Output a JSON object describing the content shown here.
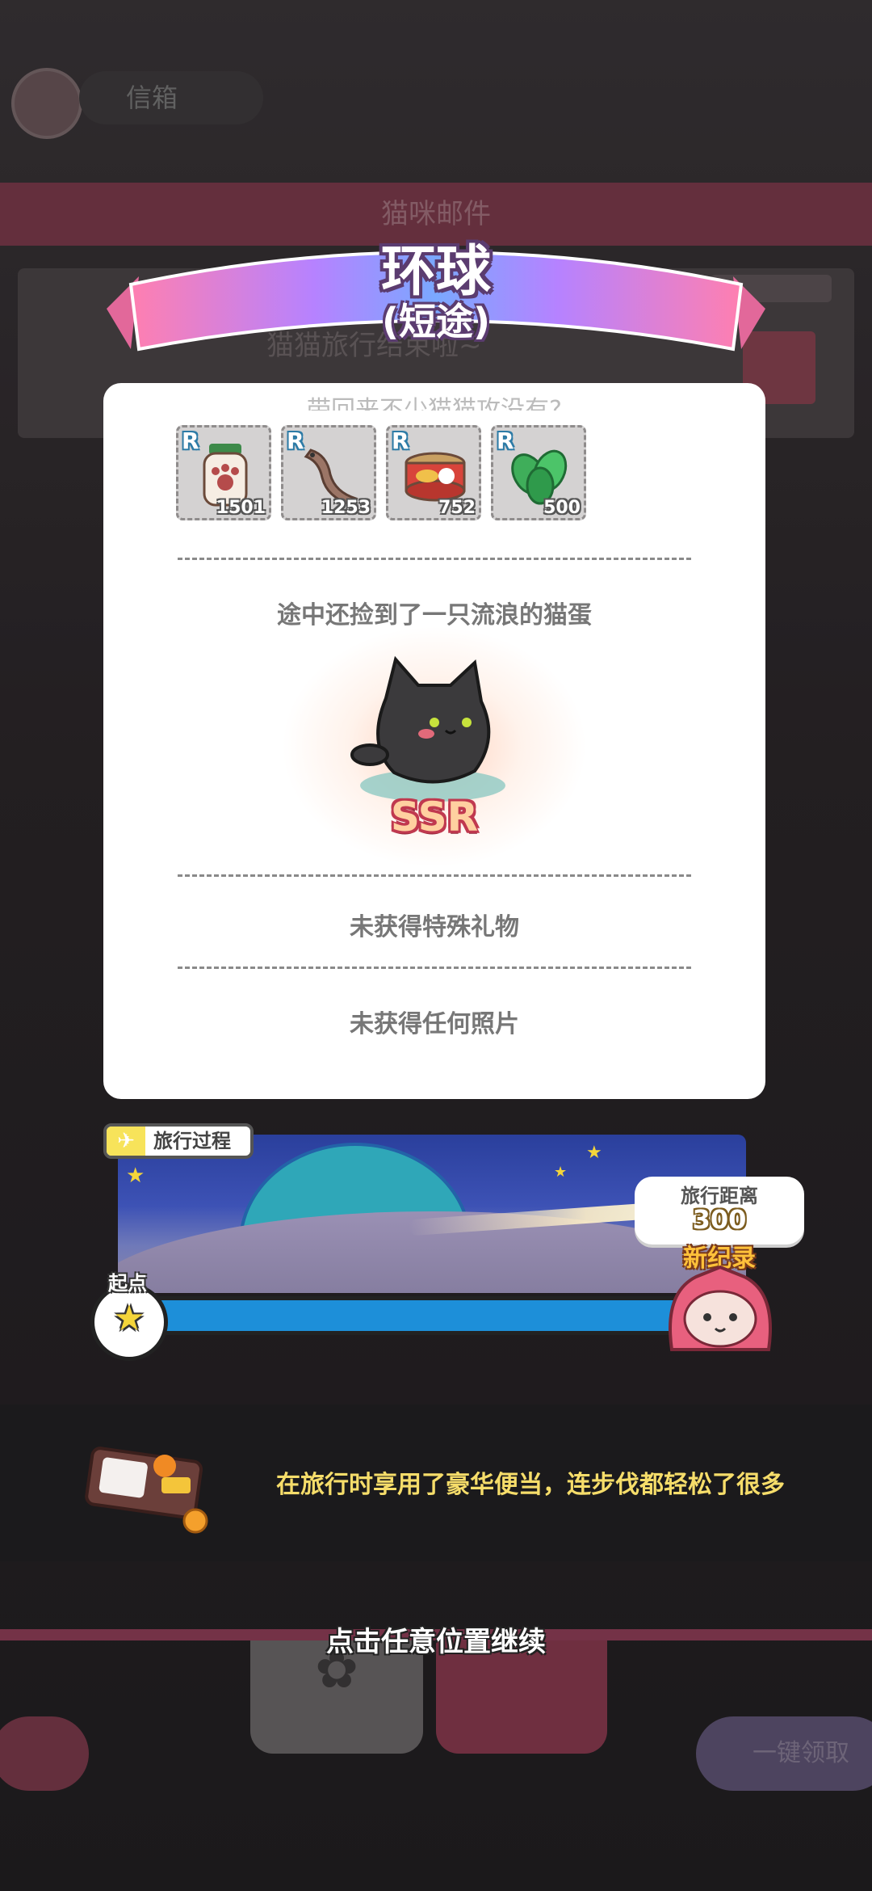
{
  "background": {
    "top_label": "信箱",
    "banner": "猫咪邮件",
    "card_text": "猫猫旅行结束啦~",
    "one_key_button": "一键领取"
  },
  "title": {
    "main": "环球",
    "sub": "(短途)"
  },
  "card": {
    "faded_line": "带回来不少猫猫攻没有?",
    "items": [
      {
        "rarity": "R",
        "icon": "paw-jar-icon",
        "qty": "1501"
      },
      {
        "rarity": "R",
        "icon": "dried-fish-icon",
        "qty": "1253"
      },
      {
        "rarity": "R",
        "icon": "cat-food-can-icon",
        "qty": "752"
      },
      {
        "rarity": "R",
        "icon": "mint-leaves-icon",
        "qty": "500"
      }
    ],
    "stray_egg_text": "途中还捡到了一只流浪的猫蛋",
    "egg_rarity": "SSR",
    "no_gift_text": "未获得特殊礼物",
    "no_photo_text": "未获得任何照片"
  },
  "travel": {
    "label": "旅行过程",
    "start_label": "起点",
    "distance_label": "旅行距离",
    "distance_value": "300",
    "new_record": "新纪录"
  },
  "bento": {
    "message": "在旅行时享用了豪华便当，连步伐都轻松了很多"
  },
  "continue_hint": "点击任意位置继续"
}
